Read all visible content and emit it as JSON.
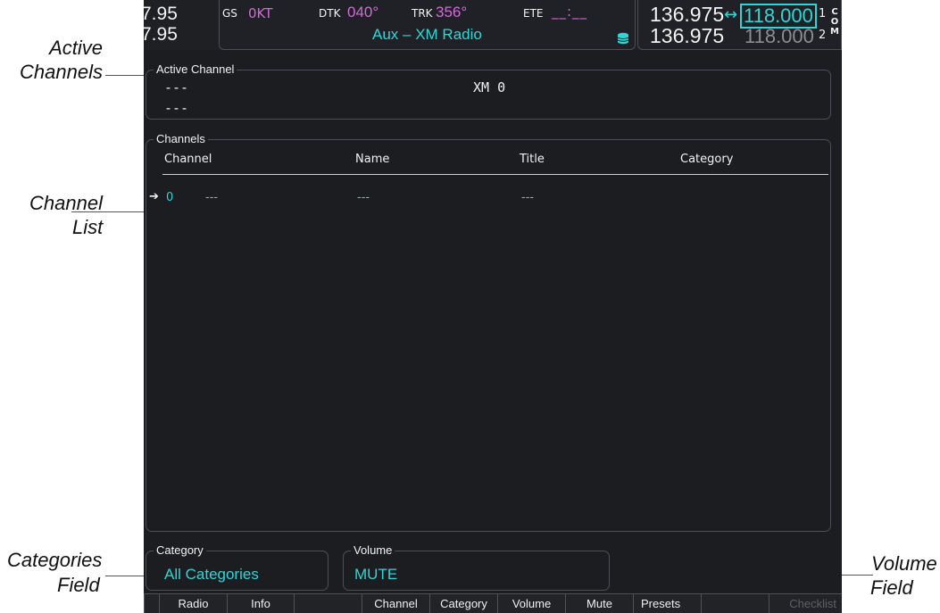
{
  "callouts": {
    "active_channels": [
      "Active",
      "Channels"
    ],
    "channel_list": [
      "Channel",
      "List"
    ],
    "categories_field": [
      "Categories",
      "Field"
    ],
    "volume_field": [
      "Volume",
      "Field"
    ]
  },
  "header": {
    "left_freq_top": "7.95",
    "left_freq_bottom": "7.95",
    "gs_label": "GS",
    "gs_value": "0KT",
    "dtk_label": "DTK",
    "dtk_value": "040°",
    "trk_label": "TRK",
    "trk_value": "356°",
    "ete_label": "ETE",
    "ete_value": "__:__",
    "page_title": "Aux – XM Radio",
    "com1_active": "136.975",
    "com1_swap": "↔",
    "com1_standby": "118.000",
    "com2_active": "136.975",
    "com2_standby": "118.000",
    "com1_tag": "1",
    "com2_tag": "2",
    "com_letters": "COM"
  },
  "active_channel": {
    "title": "Active Channel",
    "line1": "---",
    "line2": "---",
    "center": "XM 0"
  },
  "channels": {
    "title": "Channels",
    "headers": [
      "Channel",
      "Name",
      "Title",
      "Category"
    ],
    "rows": [
      {
        "channel": "0",
        "name": "---",
        "title": "---",
        "extra": "---"
      }
    ]
  },
  "category": {
    "title": "Category",
    "value": "All Categories"
  },
  "volume": {
    "title": "Volume",
    "value": "MUTE"
  },
  "softkeys": [
    "Radio",
    "Info",
    "Channel",
    "Category",
    "Volume",
    "Mute",
    "Presets",
    "Checklist"
  ]
}
